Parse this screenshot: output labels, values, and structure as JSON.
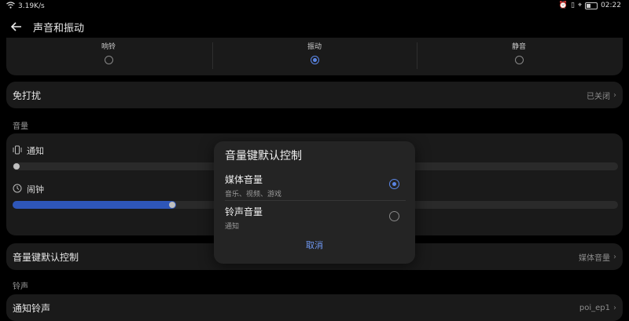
{
  "status_bar": {
    "speed": "3.19K/s",
    "time": "02:22"
  },
  "header": {
    "title": "声音和振动"
  },
  "modes": [
    {
      "label": "响铃",
      "selected": false
    },
    {
      "label": "振动",
      "selected": true
    },
    {
      "label": "静音",
      "selected": false
    }
  ],
  "dnd": {
    "label": "免打扰",
    "value": "已关闭"
  },
  "volume": {
    "section": "音量",
    "notify_label": "通知",
    "notify_level": 0.0,
    "alarm_label": "闹钟",
    "alarm_level": 0.27
  },
  "volume_key": {
    "label": "音量键默认控制",
    "value": "媒体音量"
  },
  "ringtone": {
    "section": "铃声",
    "notify_tone_label": "通知铃声",
    "notify_tone_value": "poi_ep1"
  },
  "dialog": {
    "title": "音量键默认控制",
    "options": [
      {
        "title": "媒体音量",
        "sub": "音乐、视频、游戏",
        "selected": true
      },
      {
        "title": "铃声音量",
        "sub": "通知",
        "selected": false
      }
    ],
    "cancel": "取消"
  },
  "colors": {
    "accent": "#5b86e5",
    "slider_fill": "#2e56b8",
    "background": "#000000"
  }
}
